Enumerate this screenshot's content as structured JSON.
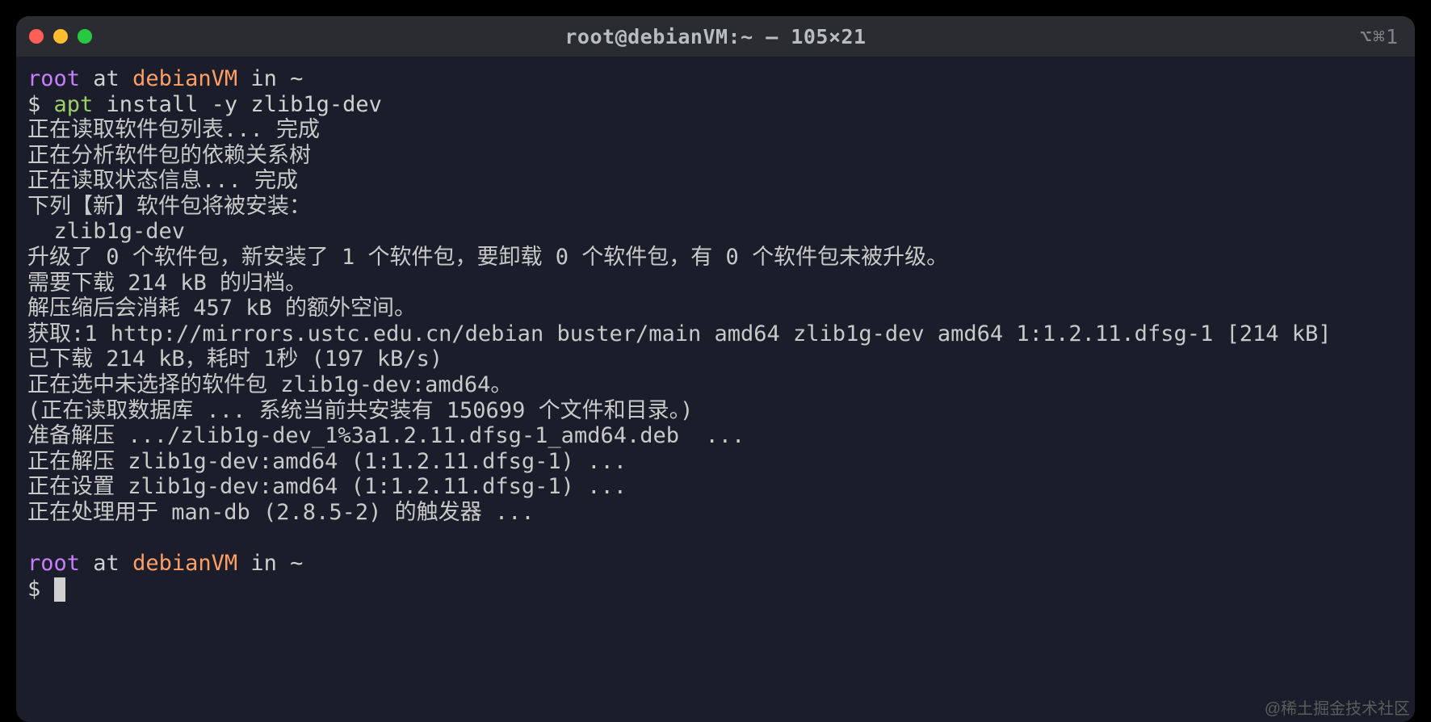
{
  "window": {
    "title": "root@debianVM:~ — 105×21",
    "right_hint": "⌥⌘1"
  },
  "prompt1": {
    "user": "root",
    "at": " at ",
    "host": "debianVM",
    "in": " in ",
    "path": "~"
  },
  "command": {
    "ps": "$ ",
    "bin": "apt",
    "rest": " install -y zlib1g-dev"
  },
  "output": [
    "正在读取软件包列表... 完成",
    "正在分析软件包的依赖关系树",
    "正在读取状态信息... 完成",
    "下列【新】软件包将被安装：",
    "  zlib1g-dev",
    "升级了 0 个软件包，新安装了 1 个软件包，要卸载 0 个软件包，有 0 个软件包未被升级。",
    "需要下载 214 kB 的归档。",
    "解压缩后会消耗 457 kB 的额外空间。",
    "获取:1 http://mirrors.ustc.edu.cn/debian buster/main amd64 zlib1g-dev amd64 1:1.2.11.dfsg-1 [214 kB]",
    "已下载 214 kB，耗时 1秒 (197 kB/s)",
    "正在选中未选择的软件包 zlib1g-dev:amd64。",
    "(正在读取数据库 ... 系统当前共安装有 150699 个文件和目录。)",
    "准备解压 .../zlib1g-dev_1%3a1.2.11.dfsg-1_amd64.deb  ...",
    "正在解压 zlib1g-dev:amd64 (1:1.2.11.dfsg-1) ...",
    "正在设置 zlib1g-dev:amd64 (1:1.2.11.dfsg-1) ...",
    "正在处理用于 man-db (2.8.5-2) 的触发器 ..."
  ],
  "blank": "",
  "prompt2": {
    "user": "root",
    "at": " at ",
    "host": "debianVM",
    "in": " in ",
    "path": "~",
    "ps": "$ "
  },
  "watermark": "@稀土掘金技术社区"
}
